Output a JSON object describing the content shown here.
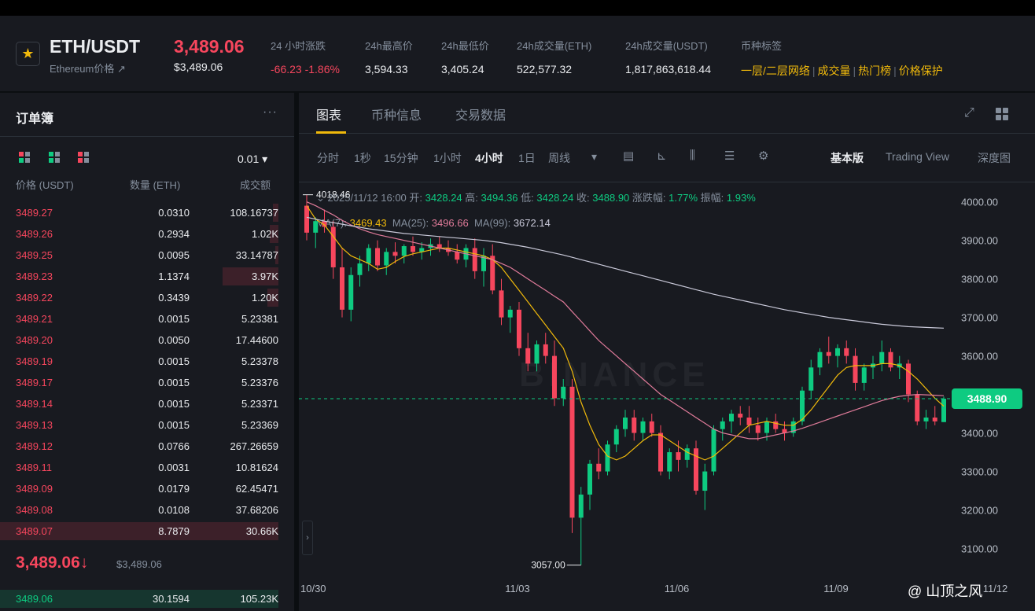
{
  "header": {
    "pair": "ETH/USDT",
    "pair_sub": "Ethereum价格 ↗",
    "last_price": "3,489.06",
    "last_price_usd": "$3,489.06",
    "stats": [
      {
        "label": "24 小时涨跌",
        "value": "-66.23 -1.86%",
        "color": "red"
      },
      {
        "label": "24h最高价",
        "value": "3,594.33"
      },
      {
        "label": "24h最低价",
        "value": "3,405.24"
      },
      {
        "label": "24h成交量(ETH)",
        "value": "522,577.32"
      },
      {
        "label": "24h成交量(USDT)",
        "value": "1,817,863,618.44"
      }
    ],
    "tags_label": "币种标签",
    "tags": [
      "一层/二层网络",
      "成交量",
      "热门榜",
      "价格保护"
    ]
  },
  "orderbook": {
    "title": "订单簿",
    "more": "···",
    "precision": "0.01 ▾",
    "columns": [
      "价格 (USDT)",
      "数量 (ETH)",
      "成交额"
    ],
    "asks": [
      {
        "price": "3489.27",
        "qty": "0.0310",
        "total": "108.16737",
        "depth": 0.02
      },
      {
        "price": "3489.26",
        "qty": "0.2934",
        "total": "1.02K",
        "depth": 0.03
      },
      {
        "price": "3489.25",
        "qty": "0.0095",
        "total": "33.14787",
        "depth": 0.01
      },
      {
        "price": "3489.23",
        "qty": "1.1374",
        "total": "3.97K",
        "depth": 0.2
      },
      {
        "price": "3489.22",
        "qty": "0.3439",
        "total": "1.20K",
        "depth": 0.04
      },
      {
        "price": "3489.21",
        "qty": "0.0015",
        "total": "5.23381",
        "depth": 0.0
      },
      {
        "price": "3489.20",
        "qty": "0.0050",
        "total": "17.44600",
        "depth": 0.0
      },
      {
        "price": "3489.19",
        "qty": "0.0015",
        "total": "5.23378",
        "depth": 0.0
      },
      {
        "price": "3489.17",
        "qty": "0.0015",
        "total": "5.23376",
        "depth": 0.0
      },
      {
        "price": "3489.14",
        "qty": "0.0015",
        "total": "5.23371",
        "depth": 0.0
      },
      {
        "price": "3489.13",
        "qty": "0.0015",
        "total": "5.23369",
        "depth": 0.0
      },
      {
        "price": "3489.12",
        "qty": "0.0766",
        "total": "267.26659",
        "depth": 0.0
      },
      {
        "price": "3489.11",
        "qty": "0.0031",
        "total": "10.81624",
        "depth": 0.0
      },
      {
        "price": "3489.09",
        "qty": "0.0179",
        "total": "62.45471",
        "depth": 0.0
      },
      {
        "price": "3489.08",
        "qty": "0.0108",
        "total": "37.68206",
        "depth": 0.0
      },
      {
        "price": "3489.07",
        "qty": "8.7879",
        "total": "30.66K",
        "depth": 1.0
      }
    ],
    "mid_price": "3,489.06",
    "mid_arrow": "↓",
    "mid_usd": "$3,489.06",
    "bids": [
      {
        "price": "3489.06",
        "qty": "30.1594",
        "total": "105.23K",
        "depth": 1.0
      }
    ]
  },
  "chart_tabs": [
    "图表",
    "币种信息",
    "交易数据"
  ],
  "toolbar": {
    "intervals": [
      "分时",
      "1秒",
      "15分钟",
      "1小时",
      "4小时",
      "1日",
      "周线"
    ],
    "active_interval": "4小时",
    "more": "▾",
    "versions": [
      "基本版",
      "Trading View",
      "深度图"
    ],
    "active_version": "基本版"
  },
  "ohlc": {
    "toggle": "⌄",
    "time": "2025/11/12 16:00",
    "open_label": "开:",
    "open": "3428.24",
    "high_label": "高:",
    "high": "3494.36",
    "low_label": "低:",
    "low": "3428.24",
    "close_label": "收:",
    "close": "3488.90",
    "change_label": "涨跌幅:",
    "change": "1.77%",
    "amp_label": "振幅:",
    "amp": "1.93%"
  },
  "ma": {
    "ma7_label": "MA(7):",
    "ma7": "3469.43",
    "ma25_label": "MA(25):",
    "ma25": "3496.66",
    "ma99_label": "MA(99):",
    "ma99": "3672.14"
  },
  "watermark": "BINANCE",
  "credit": "@ 山顶之风",
  "colors": {
    "up": "#0ecb81",
    "down": "#f6465d",
    "ma7": "#f0b90b",
    "ma25": "#e07b9a",
    "ma99": "#c9c9d9"
  },
  "chart_data": {
    "type": "candlestick",
    "interval": "4h",
    "ylim": [
      3050,
      4030
    ],
    "y_ticks": [
      "4000.00",
      "3900.00",
      "3800.00",
      "3700.00",
      "3600.00",
      "3500.00",
      "3400.00",
      "3300.00",
      "3200.00",
      "3100.00"
    ],
    "x_ticks": [
      {
        "label": "10/30",
        "index": 0
      },
      {
        "label": "11/03",
        "index": 24
      },
      {
        "label": "11/06",
        "index": 42
      },
      {
        "label": "11/09",
        "index": 60
      },
      {
        "label": "11/12",
        "index": 78
      }
    ],
    "current_price_label": "3488.90",
    "current_price": 3488.9,
    "max_label": "4018.46",
    "max_value": 4018.46,
    "min_label": "3057.00",
    "min_value": 3057.0,
    "candles": [
      [
        3990,
        4018,
        3900,
        3920
      ],
      [
        3920,
        3960,
        3880,
        3950
      ],
      [
        3950,
        3980,
        3920,
        3935
      ],
      [
        3935,
        3950,
        3800,
        3830
      ],
      [
        3830,
        3880,
        3700,
        3720
      ],
      [
        3720,
        3830,
        3690,
        3810
      ],
      [
        3810,
        3860,
        3780,
        3840
      ],
      [
        3840,
        3890,
        3820,
        3880
      ],
      [
        3880,
        3900,
        3820,
        3835
      ],
      [
        3835,
        3880,
        3810,
        3870
      ],
      [
        3870,
        3895,
        3840,
        3860
      ],
      [
        3860,
        3890,
        3840,
        3885
      ],
      [
        3885,
        3910,
        3860,
        3870
      ],
      [
        3870,
        3895,
        3850,
        3880
      ],
      [
        3880,
        3905,
        3860,
        3890
      ],
      [
        3890,
        3910,
        3870,
        3880
      ],
      [
        3880,
        3900,
        3860,
        3870
      ],
      [
        3870,
        3890,
        3840,
        3850
      ],
      [
        3850,
        3890,
        3830,
        3880
      ],
      [
        3880,
        3905,
        3800,
        3820
      ],
      [
        3820,
        3880,
        3780,
        3860
      ],
      [
        3860,
        3890,
        3760,
        3770
      ],
      [
        3770,
        3800,
        3680,
        3700
      ],
      [
        3700,
        3730,
        3660,
        3720
      ],
      [
        3720,
        3740,
        3600,
        3620
      ],
      [
        3620,
        3660,
        3560,
        3580
      ],
      [
        3580,
        3640,
        3560,
        3630
      ],
      [
        3630,
        3660,
        3580,
        3600
      ],
      [
        3600,
        3640,
        3470,
        3490
      ],
      [
        3490,
        3540,
        3470,
        3520
      ],
      [
        3520,
        3540,
        3140,
        3180
      ],
      [
        3180,
        3260,
        3057,
        3240
      ],
      [
        3240,
        3330,
        3200,
        3320
      ],
      [
        3320,
        3360,
        3280,
        3300
      ],
      [
        3300,
        3380,
        3290,
        3370
      ],
      [
        3370,
        3420,
        3350,
        3410
      ],
      [
        3410,
        3460,
        3390,
        3440
      ],
      [
        3440,
        3460,
        3380,
        3400
      ],
      [
        3400,
        3440,
        3380,
        3430
      ],
      [
        3430,
        3450,
        3390,
        3400
      ],
      [
        3400,
        3420,
        3290,
        3300
      ],
      [
        3300,
        3360,
        3280,
        3350
      ],
      [
        3350,
        3380,
        3300,
        3330
      ],
      [
        3330,
        3370,
        3310,
        3360
      ],
      [
        3360,
        3380,
        3240,
        3250
      ],
      [
        3250,
        3320,
        3200,
        3300
      ],
      [
        3300,
        3420,
        3290,
        3410
      ],
      [
        3410,
        3440,
        3380,
        3430
      ],
      [
        3430,
        3460,
        3400,
        3450
      ],
      [
        3450,
        3470,
        3420,
        3440
      ],
      [
        3440,
        3470,
        3400,
        3420
      ],
      [
        3420,
        3440,
        3380,
        3400
      ],
      [
        3400,
        3440,
        3380,
        3430
      ],
      [
        3430,
        3450,
        3400,
        3410
      ],
      [
        3410,
        3430,
        3380,
        3400
      ],
      [
        3400,
        3440,
        3390,
        3430
      ],
      [
        3430,
        3520,
        3420,
        3510
      ],
      [
        3510,
        3590,
        3490,
        3570
      ],
      [
        3570,
        3620,
        3550,
        3610
      ],
      [
        3610,
        3650,
        3580,
        3600
      ],
      [
        3600,
        3630,
        3570,
        3620
      ],
      [
        3620,
        3640,
        3580,
        3600
      ],
      [
        3600,
        3620,
        3510,
        3530
      ],
      [
        3530,
        3580,
        3510,
        3570
      ],
      [
        3570,
        3600,
        3540,
        3580
      ],
      [
        3580,
        3640,
        3560,
        3610
      ],
      [
        3610,
        3620,
        3560,
        3570
      ],
      [
        3570,
        3600,
        3540,
        3580
      ],
      [
        3580,
        3590,
        3480,
        3500
      ],
      [
        3500,
        3510,
        3420,
        3430
      ],
      [
        3430,
        3460,
        3410,
        3440
      ],
      [
        3440,
        3470,
        3420,
        3430
      ],
      [
        3428.24,
        3494.36,
        3428.24,
        3488.9
      ]
    ],
    "series": [
      {
        "name": "MA(7)",
        "values": [
          3990,
          3955,
          3940,
          3910,
          3880,
          3860,
          3850,
          3840,
          3825,
          3830,
          3845,
          3858,
          3865,
          3870,
          3875,
          3880,
          3880,
          3875,
          3870,
          3865,
          3860,
          3850,
          3830,
          3800,
          3770,
          3740,
          3710,
          3680,
          3650,
          3620,
          3560,
          3480,
          3420,
          3370,
          3340,
          3330,
          3340,
          3360,
          3380,
          3395,
          3395,
          3380,
          3365,
          3350,
          3340,
          3330,
          3340,
          3360,
          3380,
          3400,
          3420,
          3425,
          3430,
          3425,
          3420,
          3420,
          3435,
          3460,
          3490,
          3520,
          3550,
          3570,
          3575,
          3575,
          3575,
          3580,
          3580,
          3575,
          3560,
          3540,
          3515,
          3490,
          3469.43
        ]
      },
      {
        "name": "MA(25)",
        "values": [
          4000,
          3990,
          3978,
          3966,
          3952,
          3940,
          3930,
          3922,
          3915,
          3910,
          3905,
          3900,
          3895,
          3890,
          3885,
          3880,
          3875,
          3870,
          3865,
          3860,
          3855,
          3850,
          3840,
          3830,
          3815,
          3800,
          3785,
          3770,
          3755,
          3740,
          3715,
          3690,
          3665,
          3640,
          3620,
          3600,
          3580,
          3560,
          3540,
          3520,
          3500,
          3485,
          3470,
          3455,
          3440,
          3425,
          3410,
          3400,
          3395,
          3390,
          3385,
          3385,
          3390,
          3395,
          3400,
          3405,
          3412,
          3420,
          3428,
          3436,
          3444,
          3452,
          3460,
          3468,
          3476,
          3484,
          3490,
          3495,
          3498,
          3500,
          3499,
          3498,
          3496.66
        ]
      },
      {
        "name": "MA(99)",
        "values": [
          3960,
          3955,
          3950,
          3946,
          3942,
          3938,
          3934,
          3930,
          3927,
          3924,
          3921,
          3918,
          3916,
          3914,
          3912,
          3910,
          3908,
          3906,
          3904,
          3902,
          3900,
          3897,
          3894,
          3890,
          3886,
          3882,
          3877,
          3872,
          3867,
          3862,
          3856,
          3850,
          3844,
          3838,
          3832,
          3826,
          3820,
          3814,
          3808,
          3802,
          3796,
          3790,
          3784,
          3778,
          3772,
          3766,
          3760,
          3755,
          3750,
          3745,
          3740,
          3735,
          3730,
          3725,
          3720,
          3716,
          3712,
          3708,
          3704,
          3700,
          3697,
          3694,
          3691,
          3688,
          3685,
          3682,
          3680,
          3678,
          3676,
          3675,
          3674,
          3673,
          3672.14
        ]
      }
    ]
  }
}
